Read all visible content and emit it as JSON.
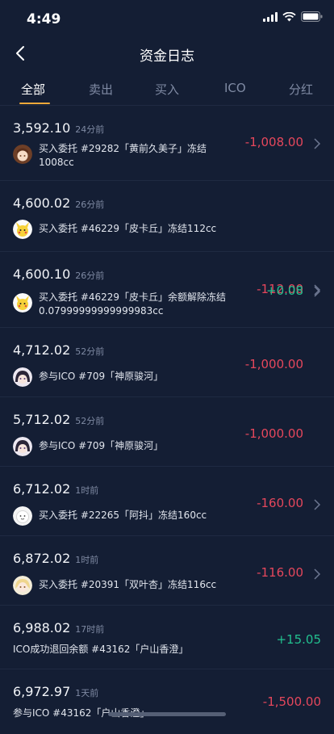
{
  "status": {
    "time": "4:49"
  },
  "nav": {
    "title": "资金日志"
  },
  "tabs": [
    {
      "label": "全部",
      "active": true
    },
    {
      "label": "卖出"
    },
    {
      "label": "买入"
    },
    {
      "label": "ICO"
    },
    {
      "label": "分红"
    }
  ],
  "entries": [
    {
      "balance": "3,592.10",
      "time": "24分前",
      "desc_line1": "买入委托 #29282「黄前久美子」冻结",
      "desc_line2": "1008cc",
      "amount": "-1,008.00",
      "sign": "neg",
      "avatar": "anime-girl-brown-hair",
      "chevron": true
    },
    {
      "balance": "4,600.02",
      "time": "26分前",
      "desc_line1": "买入委托 #46229「皮卡丘」冻结112cc",
      "desc_line2": "",
      "amount": "-112.00",
      "sign": "neg",
      "avatar": "pikachu",
      "chevron": true
    },
    {
      "balance": "4,600.10",
      "time": "26分前",
      "desc_line1": "买入委托 #46229「皮卡丘」余额解除冻结",
      "desc_line2": "0.07999999999999983cc",
      "amount": "+0.08",
      "sign": "pos",
      "avatar": "pikachu",
      "chevron": true
    },
    {
      "balance": "4,712.02",
      "time": "52分前",
      "desc_line1": "参与ICO #709「神原骏河」",
      "desc_line2": "",
      "amount": "-1,000.00",
      "sign": "neg",
      "avatar": "anime-girl-dark-hair",
      "chevron": false
    },
    {
      "balance": "5,712.02",
      "time": "52分前",
      "desc_line1": "参与ICO #709「神原骏河」",
      "desc_line2": "",
      "amount": "-1,000.00",
      "sign": "neg",
      "avatar": "anime-girl-dark-hair",
      "chevron": false
    },
    {
      "balance": "6,712.02",
      "time": "1时前",
      "desc_line1": "买入委托 #22265「阿抖」冻结160cc",
      "desc_line2": "",
      "amount": "-160.00",
      "sign": "neg",
      "avatar": "white-blob",
      "chevron": true
    },
    {
      "balance": "6,872.02",
      "time": "1时前",
      "desc_line1": "买入委托 #20391「双叶杏」冻结116cc",
      "desc_line2": "",
      "amount": "-116.00",
      "sign": "neg",
      "avatar": "anime-girl-blonde",
      "chevron": true
    },
    {
      "balance": "6,988.02",
      "time": "17时前",
      "desc_line1": "ICO成功退回余额 #43162「户山香澄」",
      "desc_line2": "",
      "amount": "+15.05",
      "sign": "pos",
      "avatar": "",
      "chevron": false
    },
    {
      "balance": "6,972.97",
      "time": "1天前",
      "desc_line1": "参与ICO #43162「户山香澄」",
      "desc_line2": "",
      "amount": "-1,500.00",
      "sign": "neg",
      "avatar": "",
      "chevron": false
    }
  ],
  "colors": {
    "background": "#141e34",
    "negative": "#e5475c",
    "positive": "#22c08f",
    "tab_underline": "#f4a93a"
  }
}
